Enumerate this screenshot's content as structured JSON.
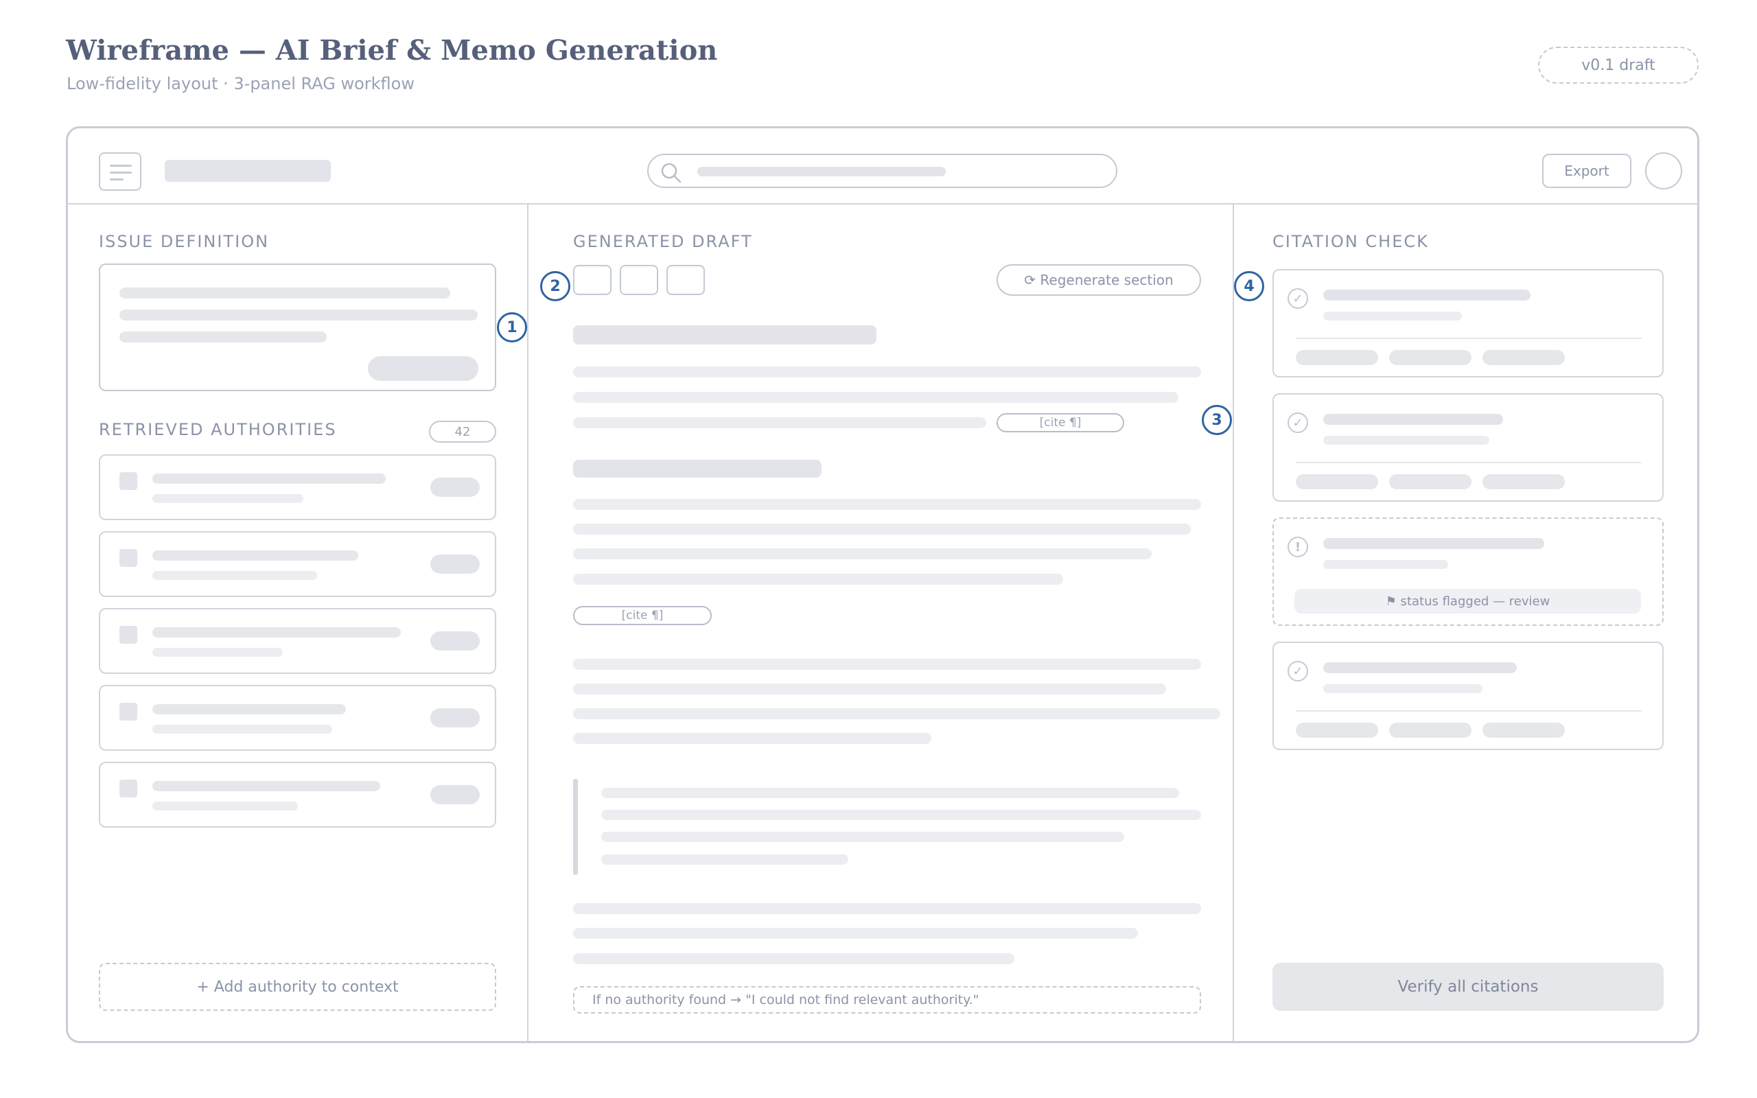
{
  "header": {
    "title": "Wireframe — AI Brief & Memo Generation",
    "subtitle": "Low-fidelity layout · 3-panel RAG workflow",
    "version_badge": "v0.1 draft"
  },
  "topbar": {
    "export_label": "Export"
  },
  "left_panel": {
    "issue_heading": "ISSUE DEFINITION",
    "authorities_heading": "RETRIEVED AUTHORITIES",
    "authorities_count": "42",
    "add_authority_label": "+ Add authority to context"
  },
  "center_panel": {
    "heading": "GENERATED DRAFT",
    "regenerate_label": "⟳ Regenerate section",
    "cite_label_1": "[cite ¶]",
    "cite_label_2": "[cite ¶]",
    "fallback_note": "If no authority found → \"I could not find relevant authority.\""
  },
  "right_panel": {
    "heading": "CITATION CHECK",
    "check_glyph": "✓",
    "flag_glyph": "!",
    "flag_status": "⚑ status flagged — review",
    "verify_label": "Verify all citations"
  },
  "callouts": {
    "c1": "1",
    "c2": "2",
    "c3": "3",
    "c4": "4"
  },
  "colors": {
    "callout": "#2f63a3",
    "border": "#c8ccd6",
    "placeholder": "#e5e7eb"
  },
  "icons": [
    "menu-icon",
    "search-icon",
    "check-circle-icon",
    "alert-circle-icon",
    "refresh-icon",
    "flag-icon"
  ]
}
